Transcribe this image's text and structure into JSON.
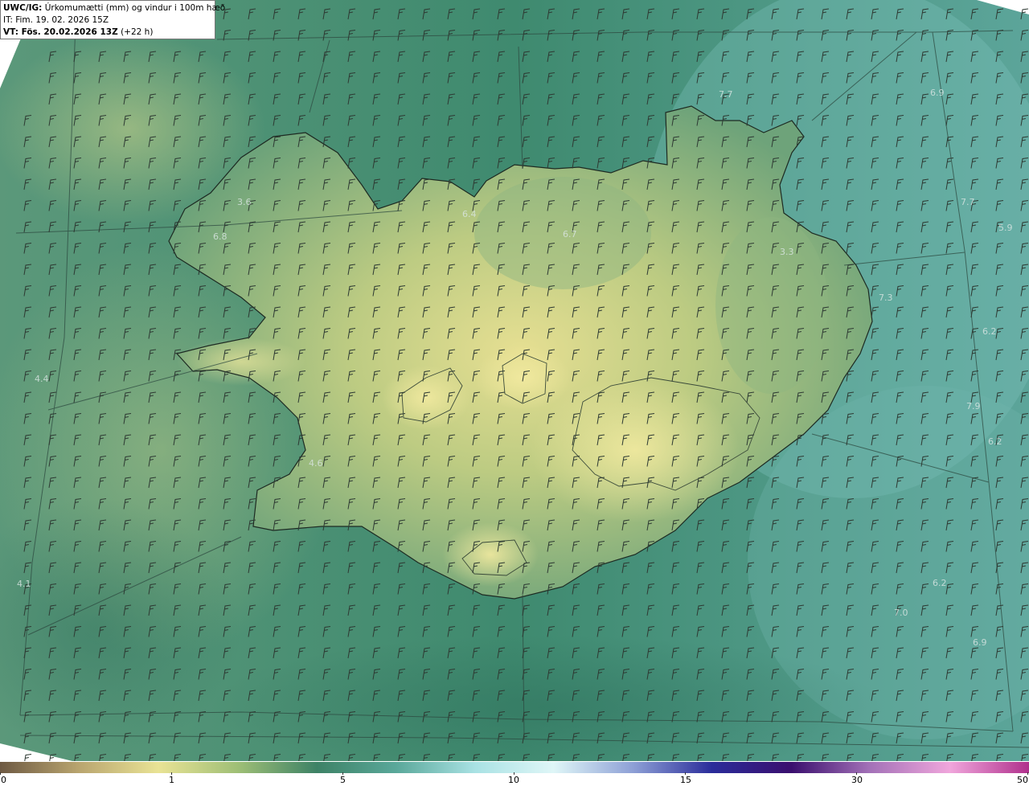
{
  "header": {
    "model_label": "UWC/IG:",
    "title": "Úrkomumætti (mm) og vindur i 100m hæð",
    "init_time": "IT: Fim. 19. 02. 2026 15Z",
    "valid_prefix": "VT: Fös. 20.02.2026 13Z",
    "valid_suffix": "(+22 h)"
  },
  "map_labels": [
    {
      "text": "7.7"
    },
    {
      "text": "6.9"
    },
    {
      "text": "3.6"
    },
    {
      "text": "6.8"
    },
    {
      "text": "6.4"
    },
    {
      "text": "6.7"
    },
    {
      "text": "7.7"
    },
    {
      "text": "5.9"
    },
    {
      "text": "3.3"
    },
    {
      "text": "7.3"
    },
    {
      "text": "6.2"
    },
    {
      "text": "4.4"
    },
    {
      "text": "7.9"
    },
    {
      "text": "6.2"
    },
    {
      "text": "4.6"
    },
    {
      "text": "4.1"
    },
    {
      "text": "6.2"
    },
    {
      "text": "7.0"
    },
    {
      "text": "6.9"
    }
  ],
  "colorbar": {
    "ticks": [
      "0",
      "1",
      "5",
      "10",
      "15",
      "30",
      "50"
    ],
    "colors": [
      "#6e5a43",
      "#b9a56f",
      "#e9e395",
      "#9fbf76",
      "#3d8266",
      "#5aa89a",
      "#a9e2e4",
      "#dff6f7",
      "#8ea0d6",
      "#2a2c9a",
      "#3a0f6e",
      "#a472b8",
      "#f0a6dc",
      "#b0308c"
    ]
  }
}
